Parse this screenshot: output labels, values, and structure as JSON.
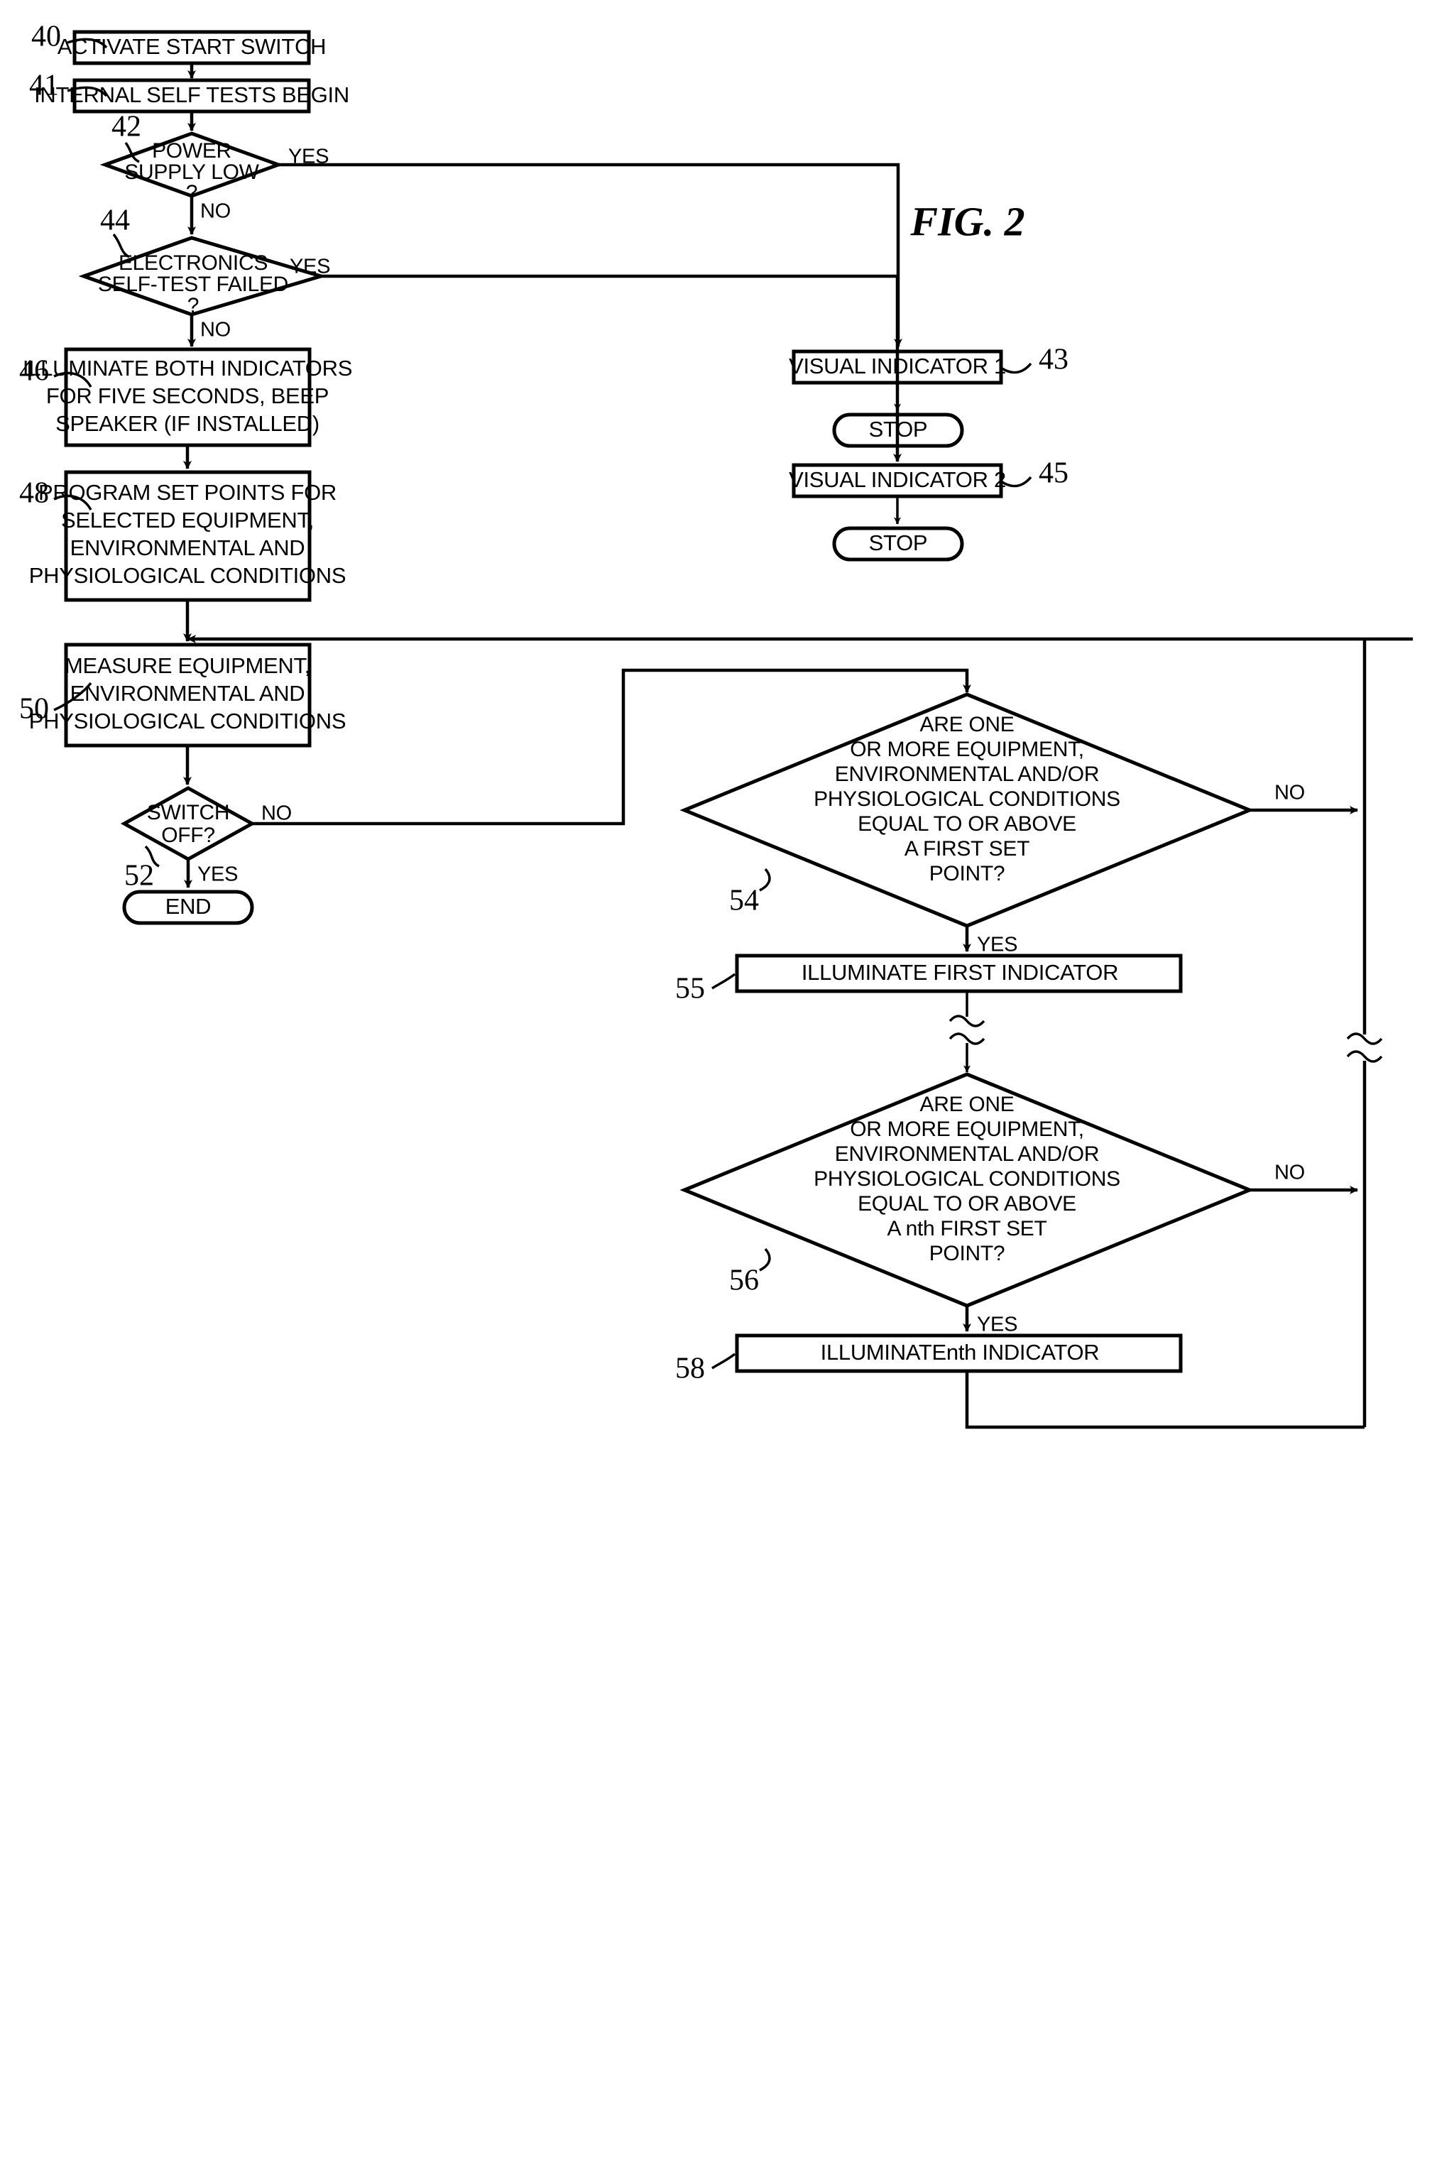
{
  "figure": {
    "label": "FIG. 2",
    "type": "patent-flowchart"
  },
  "nodes": [
    {
      "id": "n40",
      "ref": "40",
      "shape": "process",
      "text": [
        "ACTIVATE START SWITCH"
      ]
    },
    {
      "id": "n41",
      "ref": "41",
      "shape": "process",
      "text": [
        "INTERNAL SELF TESTS BEGIN"
      ]
    },
    {
      "id": "n42",
      "ref": "42",
      "shape": "decision",
      "text": [
        "POWER",
        "SUPPLY LOW",
        "?"
      ]
    },
    {
      "id": "n43",
      "ref": "43",
      "shape": "process",
      "text": [
        "VISUAL INDICATOR 1"
      ]
    },
    {
      "id": "stop1",
      "ref": "",
      "shape": "terminator",
      "text": [
        "STOP"
      ]
    },
    {
      "id": "n44",
      "ref": "44",
      "shape": "decision",
      "text": [
        "ELECTRONICS",
        "SELF-TEST FAILED",
        "?"
      ]
    },
    {
      "id": "n45",
      "ref": "45",
      "shape": "process",
      "text": [
        "VISUAL INDICATOR 2"
      ]
    },
    {
      "id": "stop2",
      "ref": "",
      "shape": "terminator",
      "text": [
        "STOP"
      ]
    },
    {
      "id": "n46",
      "ref": "46",
      "shape": "process",
      "text": [
        "ILLUMINATE BOTH INDICATORS",
        "FOR FIVE SECONDS, BEEP",
        "SPEAKER (IF INSTALLED)"
      ]
    },
    {
      "id": "n48",
      "ref": "48",
      "shape": "process",
      "text": [
        "PROGRAM SET POINTS FOR",
        "SELECTED EQUIPMENT,",
        "ENVIRONMENTAL AND",
        "PHYSIOLOGICAL CONDITIONS"
      ]
    },
    {
      "id": "n50",
      "ref": "50",
      "shape": "process",
      "text": [
        "MEASURE EQUIPMENT,",
        "ENVIRONMENTAL AND",
        "PHYSIOLOGICAL CONDITIONS"
      ]
    },
    {
      "id": "n52",
      "ref": "52",
      "shape": "decision",
      "text": [
        "SWITCH",
        "OFF?"
      ]
    },
    {
      "id": "end",
      "ref": "",
      "shape": "terminator",
      "text": [
        "END"
      ]
    },
    {
      "id": "n54",
      "ref": "54",
      "shape": "decision",
      "text": [
        "ARE ONE",
        "OR MORE EQUIPMENT,",
        "ENVIRONMENTAL AND/OR",
        "PHYSIOLOGICAL CONDITIONS",
        "EQUAL TO OR ABOVE",
        "A FIRST SET",
        "POINT?"
      ]
    },
    {
      "id": "n55",
      "ref": "55",
      "shape": "process",
      "text": [
        "ILLUMINATE FIRST INDICATOR"
      ]
    },
    {
      "id": "n56",
      "ref": "56",
      "shape": "decision",
      "text": [
        "ARE ONE",
        "OR MORE EQUIPMENT,",
        "ENVIRONMENTAL AND/OR",
        "PHYSIOLOGICAL CONDITIONS",
        "EQUAL TO OR ABOVE",
        "A nth FIRST SET",
        "POINT?"
      ]
    },
    {
      "id": "n58",
      "ref": "58",
      "shape": "process",
      "text": [
        "ILLUMINATEnth INDICATOR"
      ]
    }
  ],
  "edge_labels": {
    "yes1": "YES",
    "no1": "NO",
    "yes2": "YES",
    "no2": "NO",
    "no_switch": "NO",
    "yes_switch": "YES",
    "no54": "NO",
    "yes54": "YES",
    "no56": "NO",
    "yes56": "YES"
  },
  "colors": {
    "ink": "#000000",
    "paper": "#ffffff"
  }
}
